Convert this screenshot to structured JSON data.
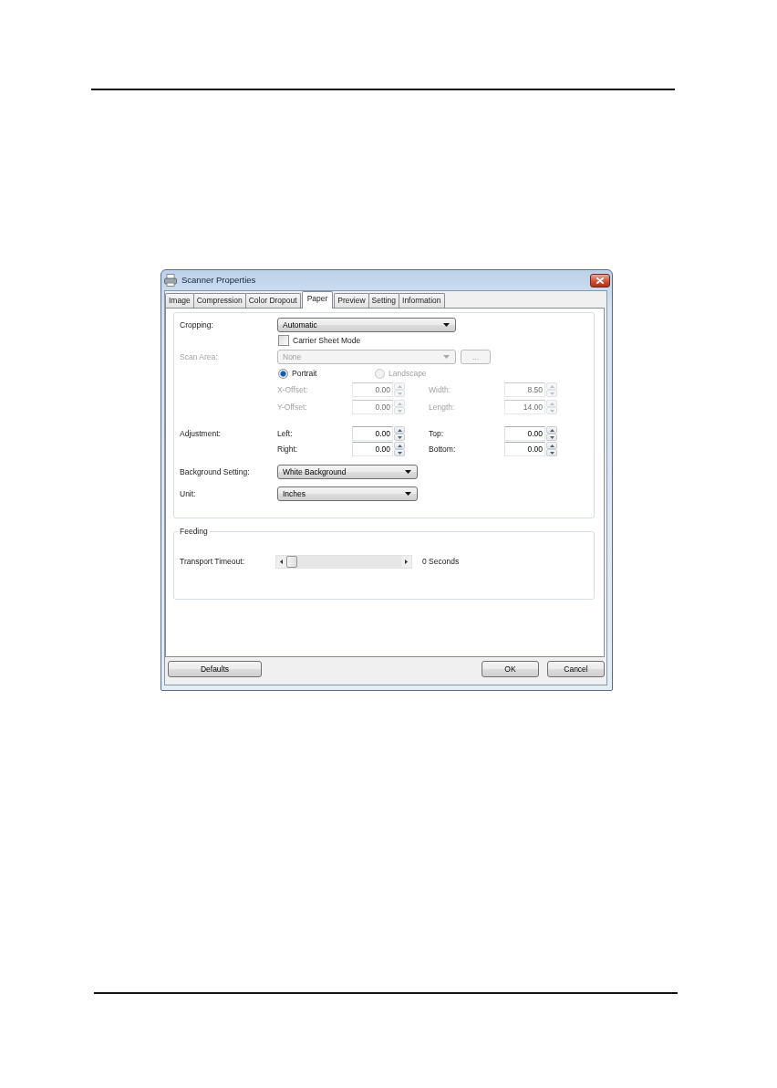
{
  "window": {
    "title": "Scanner Properties"
  },
  "tabs": [
    {
      "label": "Image",
      "selected": false
    },
    {
      "label": "Compression",
      "selected": false
    },
    {
      "label": "Color Dropout",
      "selected": false
    },
    {
      "label": "Paper",
      "selected": true
    },
    {
      "label": "Preview",
      "selected": false
    },
    {
      "label": "Setting",
      "selected": false
    },
    {
      "label": "Information",
      "selected": false
    }
  ],
  "cropping": {
    "label": "Cropping:",
    "value": "Automatic"
  },
  "carrier_sheet_mode": {
    "label": "Carrier Sheet Mode",
    "checked": false
  },
  "scan_area": {
    "label": "Scan Area:",
    "value": "None",
    "disabled": true,
    "button": "..."
  },
  "orientation": [
    {
      "label": "Portrait",
      "selected": true,
      "disabled": false
    },
    {
      "label": "Landscape",
      "selected": false,
      "disabled": true
    }
  ],
  "paper_fields": [
    {
      "label": "X-Offset:",
      "value": "0.00",
      "disabled": true
    },
    {
      "label": "Width:",
      "value": "8.50",
      "disabled": true
    },
    {
      "label": "Y-Offset:",
      "value": "0.00",
      "disabled": true
    },
    {
      "label": "Length:",
      "value": "14.00",
      "disabled": true
    }
  ],
  "adjustment": {
    "label": "Adjustment:",
    "fields": [
      {
        "label": "Left:",
        "value": "0.00",
        "disabled": false
      },
      {
        "label": "Top:",
        "value": "0.00",
        "disabled": false
      },
      {
        "label": "Right:",
        "value": "0.00",
        "disabled": false
      },
      {
        "label": "Bottom:",
        "value": "0.00",
        "disabled": false
      }
    ]
  },
  "background_setting": {
    "label": "Background Setting:",
    "value": "White Background"
  },
  "unit": {
    "label": "Unit:",
    "value": "Inches"
  },
  "feeding": {
    "title": "Feeding",
    "transport_timeout": {
      "label": "Transport Timeout:",
      "level": 0,
      "reading": "0 Seconds"
    }
  },
  "buttons": [
    {
      "label": "Defaults"
    },
    {
      "label": "OK"
    },
    {
      "label": "Cancel"
    }
  ]
}
